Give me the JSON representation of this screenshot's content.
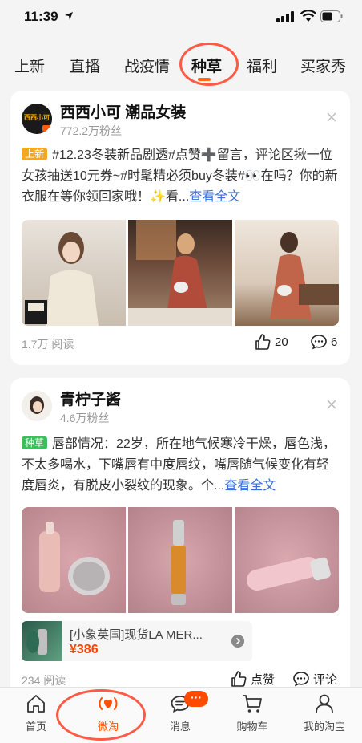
{
  "status_bar": {
    "time": "11:39"
  },
  "tabs": [
    {
      "label": "上新"
    },
    {
      "label": "直播"
    },
    {
      "label": "战疫情"
    },
    {
      "label": "种草",
      "active": true
    },
    {
      "label": "福利"
    },
    {
      "label": "买家秀"
    }
  ],
  "posts": [
    {
      "author": "西西小可 潮品女装",
      "avatar_text": "西西小可",
      "fans": "772.2万粉丝",
      "tag": "上新",
      "tag_color": "#f5a623",
      "text": "#12.23冬装新品剧透#点赞➕留言，评论区揪一位女孩抽送10元券~#时髦精必须buy冬装#👀在吗？你的新衣服在等你领回家哦！✨看...",
      "more": "查看全文",
      "views": "1.7万 阅读",
      "likes": "20",
      "comments": "6"
    },
    {
      "author": "青柠子酱",
      "fans": "4.6万粉丝",
      "tag": "种草",
      "tag_color": "#3cbf5a",
      "text": "唇部情况：22岁，所在地气候寒冷干燥，唇色浅，不太多喝水，下嘴唇有中度唇纹，嘴唇随气候变化有轻度唇炎，有脱皮小裂纹的现象。个...",
      "more": "查看全文",
      "product_title": "[小象英国]现货LA MER...",
      "product_price": "¥386",
      "views": "234 阅读",
      "like_label": "点赞",
      "comment_label": "评论"
    }
  ],
  "bottom_nav": [
    {
      "label": "首页",
      "icon": "home-icon"
    },
    {
      "label": "微淘",
      "icon": "weitao-icon",
      "active": true
    },
    {
      "label": "消息",
      "icon": "message-icon",
      "badge": "···"
    },
    {
      "label": "购物车",
      "icon": "cart-icon"
    },
    {
      "label": "我的淘宝",
      "icon": "profile-icon"
    }
  ],
  "colors": {
    "accent": "#ff5000",
    "link": "#3a6fd8",
    "annotation": "#ff5a45"
  }
}
